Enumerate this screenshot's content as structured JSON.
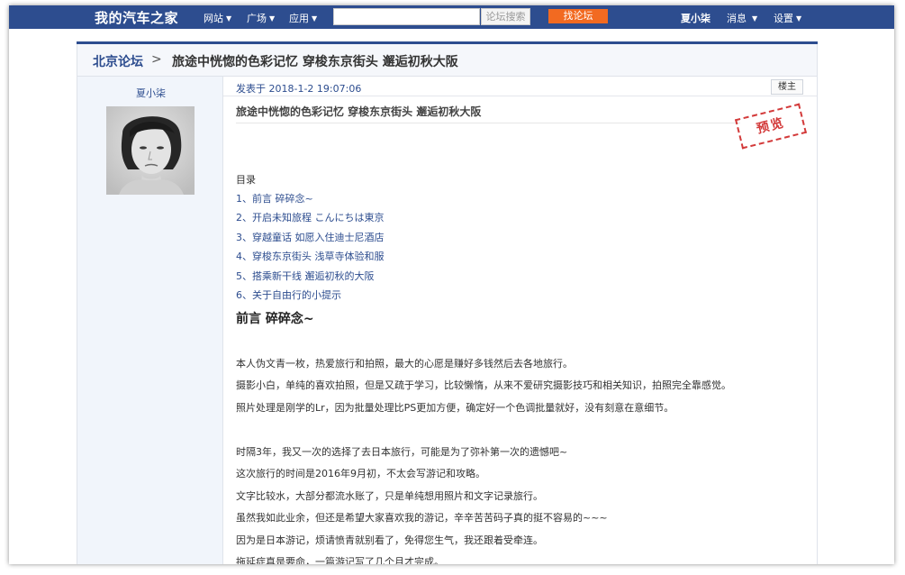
{
  "topbar": {
    "brand": "我的汽车之家",
    "nav": [
      "网站",
      "广场",
      "应用"
    ],
    "search_value": "",
    "search_button": "论坛搜索",
    "find_forum": "找论坛",
    "user": "夏小柒",
    "messages": "消息",
    "settings": "设置"
  },
  "breadcrumb": {
    "forum": "北京论坛",
    "separator": ">",
    "title": "旅途中恍惚的色彩记忆 穿梭东京街头 邂逅初秋大阪"
  },
  "author": {
    "name": "夏小柒",
    "avatar": "avatar-photo"
  },
  "post": {
    "time": "发表于 2018-1-2 19:07:06",
    "louzhu": "楼主",
    "title": "旅途中恍惚的色彩记忆 穿梭东京街头 邂逅初秋大阪",
    "stamp": "预览",
    "toc_label": "目录",
    "toc": [
      "1、前言 碎碎念~",
      "2、开启未知旅程 こんにちは東京",
      "3、穿越童话 如愿入住迪士尼酒店",
      "4、穿梭东京街头 浅草寺体验和服",
      "5、搭乘新干线 邂逅初秋的大阪",
      "6、关于自由行的小提示"
    ],
    "section_heading": "前言 碎碎念~",
    "paragraphs_a": [
      "本人伪文青一枚，热爱旅行和拍照，最大的心愿是赚好多钱然后去各地旅行。",
      "摄影小白，单纯的喜欢拍照，但是又疏于学习，比较懒惰，从来不爱研究摄影技巧和相关知识，拍照完全靠感觉。",
      "照片处理是刚学的Lr，因为批量处理比PS更加方便，确定好一个色调批量就好，没有刻意在意细节。"
    ],
    "paragraphs_b": [
      "时隔3年，我又一次的选择了去日本旅行，可能是为了弥补第一次的遗憾吧~",
      "这次旅行的时间是2016年9月初，不太会写游记和攻略。",
      "文字比较水，大部分都流水账了，只是单纯想用照片和文字记录旅行。",
      "虽然我如此业余，但还是希望大家喜欢我的游记，辛辛苦苦码子真的挺不容易的~~~",
      "因为是日本游记，烦请愤青就别看了，免得您生气，我还跟着受牵连。",
      "拖延症真是要命，一篇游记写了几个月才完成。"
    ]
  },
  "colors": {
    "topbar": "#2d4d8f",
    "find_forum": "#f26a21",
    "link": "#2d4d8f",
    "stamp": "#d33a3a"
  }
}
